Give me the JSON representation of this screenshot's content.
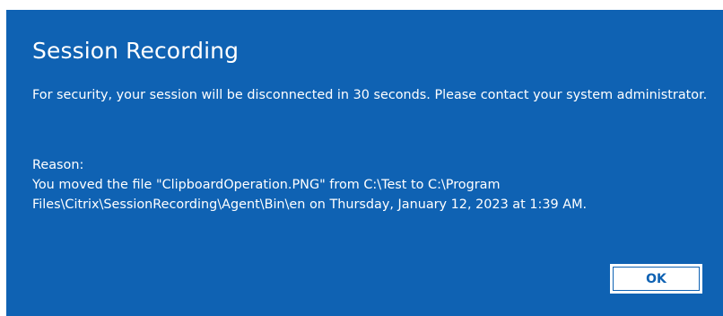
{
  "dialog": {
    "title": "Session Recording",
    "message": "For security, your session will be disconnected in 30 seconds. Please contact your system administrator.",
    "reason_label": "Reason:",
    "reason_text": "You moved the file \"ClipboardOperation.PNG\" from C:\\Test to C:\\Program Files\\Citrix\\SessionRecording\\Agent\\Bin\\en on Thursday, January 12, 2023 at 1:39 AM.",
    "ok_label": "OK"
  },
  "colors": {
    "dialog_background": "#0f62b3",
    "text": "#ffffff",
    "button_background": "#ffffff",
    "button_text": "#0f62b3"
  }
}
